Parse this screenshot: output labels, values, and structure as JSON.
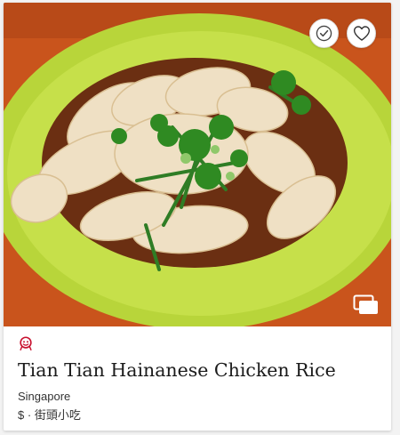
{
  "card": {
    "title": "Tian Tian Hainanese Chicken Rice",
    "location": "Singapore",
    "price": "$",
    "separator": "·",
    "cuisine": "街頭小吃"
  },
  "photo": {
    "subject": "Hainanese chicken rice dish on green plate",
    "colors": {
      "plate": "#b8d53a",
      "table": "#c9541c",
      "sauce": "#6b2f12",
      "chicken": "#efe0c4",
      "herbs": "#2f7d25"
    }
  },
  "icons": {
    "visited": "checkmark-circle-icon",
    "favorite": "heart-outline-icon",
    "gallery": "image-gallery-icon",
    "award": "bib-gourmand-icon"
  },
  "colors": {
    "award": "#c8102e",
    "title": "#1b1b1b",
    "text": "#333333"
  }
}
